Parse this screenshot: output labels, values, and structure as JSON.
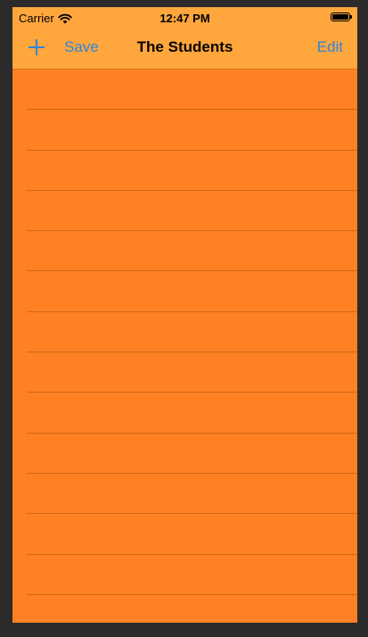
{
  "status_bar": {
    "carrier": "Carrier",
    "time": "12:47 PM",
    "wifi_icon": "wifi-icon",
    "battery_icon": "battery-icon"
  },
  "nav_bar": {
    "add_icon": "plus-icon",
    "save_label": "Save",
    "title": "The Students",
    "edit_label": "Edit"
  },
  "table": {
    "rows": [
      "",
      "",
      "",
      "",
      "",
      "",
      "",
      "",
      "",
      "",
      "",
      "",
      "",
      ""
    ]
  },
  "colors": {
    "background": "#ff8124",
    "bar": "#ffa63d",
    "tint": "#2f86d8"
  }
}
